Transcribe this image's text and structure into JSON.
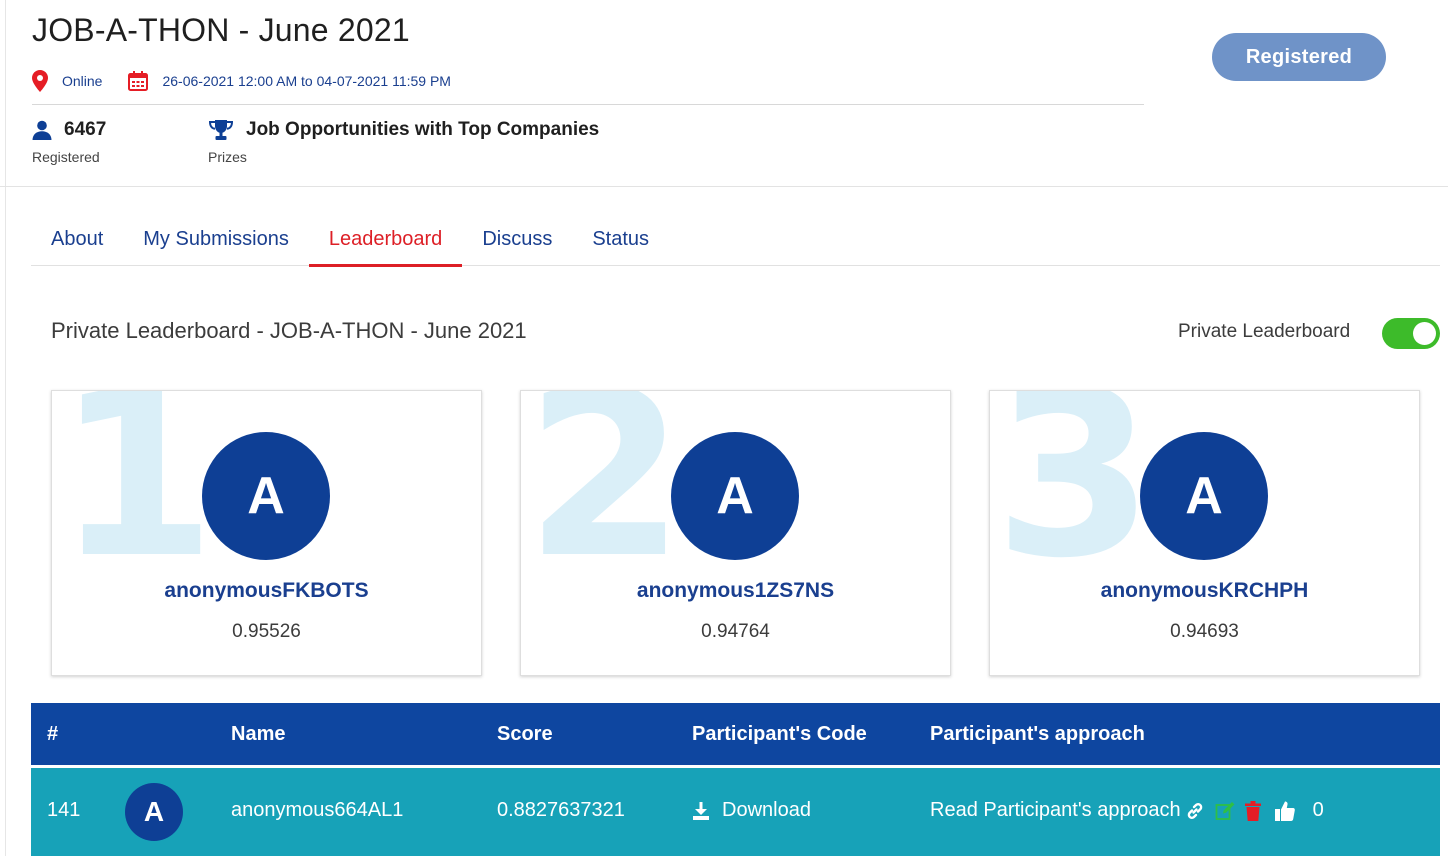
{
  "event": {
    "title": "JOB-A-THON - June 2021",
    "location": "Online",
    "date_range": "26-06-2021 12:00 AM to 04-07-2021 11:59 PM",
    "registered_count": "6467",
    "registered_label": "Registered",
    "prize": "Job Opportunities with Top Companies",
    "prize_label": "Prizes",
    "register_button": "Registered"
  },
  "tabs": [
    {
      "label": "About",
      "active": false
    },
    {
      "label": "My Submissions",
      "active": false
    },
    {
      "label": "Leaderboard",
      "active": true
    },
    {
      "label": "Discuss",
      "active": false
    },
    {
      "label": "Status",
      "active": false
    }
  ],
  "leaderboard": {
    "title": "Private Leaderboard - JOB-A-THON - June 2021",
    "toggle_label": "Private Leaderboard",
    "toggle_on": true,
    "podium": [
      {
        "rank": "1",
        "avatar": "A",
        "name": "anonymousFKBOTS",
        "score": "0.95526"
      },
      {
        "rank": "2",
        "avatar": "A",
        "name": "anonymous1ZS7NS",
        "score": "0.94764"
      },
      {
        "rank": "3",
        "avatar": "A",
        "name": "anonymousKRCHPH",
        "score": "0.94693"
      }
    ],
    "columns": [
      "#",
      "Name",
      "Score",
      "Participant's Code",
      "Participant's approach"
    ],
    "rows": [
      {
        "rank": "141",
        "avatar": "A",
        "name": "anonymous664AL1",
        "score": "0.8827637321",
        "code": "Download",
        "approach": "Read Participant's approach",
        "likes": "0"
      }
    ]
  },
  "colors": {
    "brand_blue": "#0e46a0",
    "active_tab": "#dd1f26",
    "highlight_row": "#17a2b8",
    "toggle_on": "#3dbb2a",
    "register_button": "#6f93c8"
  },
  "icons": [
    "location-pin-icon",
    "calendar-icon",
    "user-icon",
    "trophy-icon",
    "download-icon",
    "link-icon",
    "edit-icon",
    "trash-icon",
    "thumbs-up-icon"
  ]
}
